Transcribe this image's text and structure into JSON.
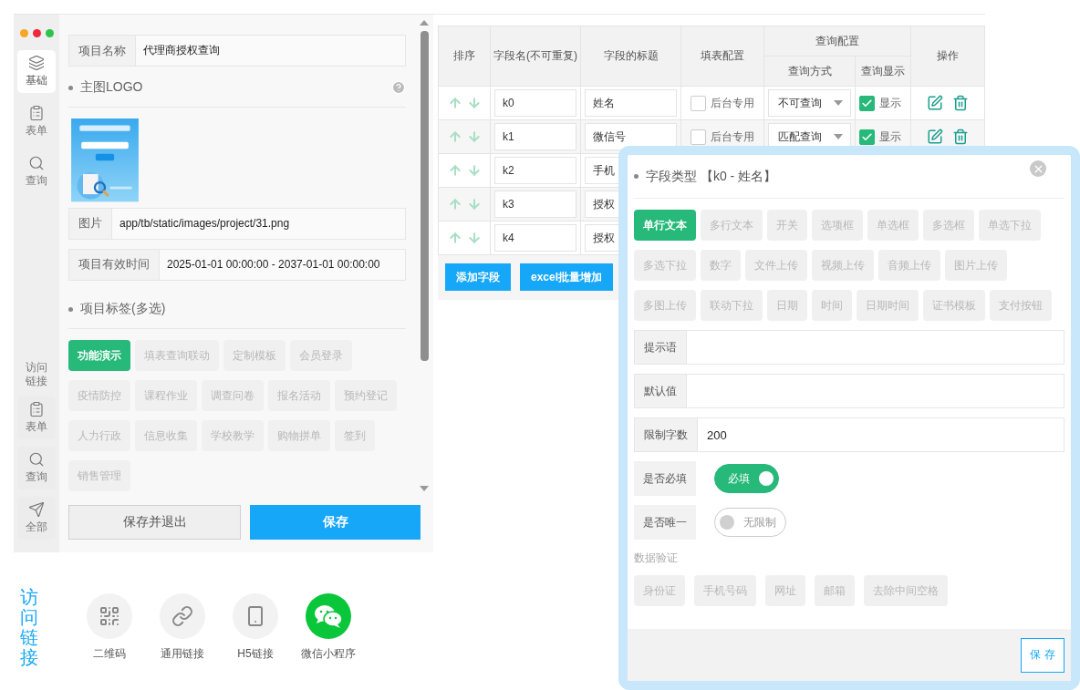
{
  "sidebar": {
    "items": [
      {
        "label": "基础",
        "selected": true
      },
      {
        "label": "表单",
        "selected": false
      },
      {
        "label": "查询",
        "selected": false
      }
    ],
    "section_label": "访问链接",
    "bottom_items": [
      {
        "label": "表单"
      },
      {
        "label": "查询"
      },
      {
        "label": "全部"
      }
    ]
  },
  "form": {
    "project_name": {
      "label": "项目名称",
      "value": "代理商授权查询"
    },
    "logo_title": "主图LOGO",
    "image_path": {
      "label": "图片",
      "value": "app/tb/static/images/project/31.png"
    },
    "valid_time": {
      "label": "项目有效时间",
      "value": "2025-01-01 00:00:00 - 2037-01-01 00:00:00"
    },
    "tags_title": "项目标签(多选)",
    "tags": [
      {
        "label": "功能演示",
        "selected": true
      },
      {
        "label": "填表查询联动",
        "selected": false
      },
      {
        "label": "定制模板",
        "selected": false
      },
      {
        "label": "会员登录",
        "selected": false
      },
      {
        "label": "疫情防控",
        "selected": false
      },
      {
        "label": "课程作业",
        "selected": false
      },
      {
        "label": "调查问卷",
        "selected": false
      },
      {
        "label": "报名活动",
        "selected": false
      },
      {
        "label": "预约登记",
        "selected": false
      },
      {
        "label": "人力行政",
        "selected": false
      },
      {
        "label": "信息收集",
        "selected": false
      },
      {
        "label": "学校教学",
        "selected": false
      },
      {
        "label": "购物拼单",
        "selected": false
      },
      {
        "label": "签到",
        "selected": false
      },
      {
        "label": "销售管理",
        "selected": false
      }
    ],
    "buttons": {
      "save_exit": "保存并退出",
      "save": "保存"
    }
  },
  "table": {
    "columns": [
      "排序",
      "字段名(不可重复)",
      "字段的标题",
      "填表配置"
    ],
    "column_group": {
      "label": "查询配置",
      "columns": [
        "查询方式",
        "查询显示"
      ]
    },
    "last_column": "操作",
    "rows": [
      {
        "key": "k0",
        "title": "姓名",
        "backend_only": {
          "label": "后台专用",
          "checked": false
        },
        "query_mode": "不可查询",
        "show": {
          "label": "显示",
          "checked": true
        }
      },
      {
        "key": "k1",
        "title": "微信号",
        "backend_only": {
          "label": "后台专用",
          "checked": false
        },
        "query_mode": "匹配查询",
        "show": {
          "label": "显示",
          "checked": true
        }
      },
      {
        "key": "k2",
        "title": "手机"
      },
      {
        "key": "k3",
        "title": "授权"
      },
      {
        "key": "k4",
        "title": "授权"
      }
    ],
    "buttons": [
      "添加字段",
      "excel批量增加"
    ]
  },
  "modal": {
    "title": "字段类型 【k0 - 姓名】",
    "field_types": [
      {
        "label": "单行文本",
        "selected": true
      },
      {
        "label": "多行文本",
        "selected": false
      },
      {
        "label": "开关",
        "selected": false
      },
      {
        "label": "选项框",
        "selected": false
      },
      {
        "label": "单选框",
        "selected": false
      },
      {
        "label": "多选框",
        "selected": false
      },
      {
        "label": "单选下拉",
        "selected": false
      },
      {
        "label": "多选下拉",
        "selected": false
      },
      {
        "label": "数字",
        "selected": false
      },
      {
        "label": "文件上传",
        "selected": false
      },
      {
        "label": "视频上传",
        "selected": false
      },
      {
        "label": "音频上传",
        "selected": false
      },
      {
        "label": "图片上传",
        "selected": false
      },
      {
        "label": "多图上传",
        "selected": false
      },
      {
        "label": "联动下拉",
        "selected": false
      },
      {
        "label": "日期",
        "selected": false
      },
      {
        "label": "时间",
        "selected": false
      },
      {
        "label": "日期时间",
        "selected": false
      },
      {
        "label": "证书模板",
        "selected": false
      },
      {
        "label": "支付按钮",
        "selected": false
      }
    ],
    "fields": [
      {
        "label": "提示语"
      },
      {
        "label": "默认值"
      },
      {
        "label": "限制字数",
        "value": "200"
      }
    ],
    "toggles": [
      {
        "label": "是否必填",
        "on": true,
        "text": "必填"
      },
      {
        "label": "是否唯一",
        "on": false,
        "text": "无限制"
      }
    ],
    "validation_title": "数据验证",
    "validations": [
      {
        "label": "身份证",
        "selected": false
      },
      {
        "label": "手机号码",
        "selected": false
      },
      {
        "label": "网址",
        "selected": false
      },
      {
        "label": "邮箱",
        "selected": false
      },
      {
        "label": "去除中间空格",
        "selected": false
      }
    ],
    "save": "保 存"
  },
  "access": {
    "title": "访问链接",
    "items": [
      {
        "label": "二维码",
        "kind": "qr"
      },
      {
        "label": "通用链接",
        "kind": "link"
      },
      {
        "label": "H5链接",
        "kind": "phone"
      },
      {
        "label": "微信小程序",
        "kind": "wechat"
      }
    ]
  }
}
